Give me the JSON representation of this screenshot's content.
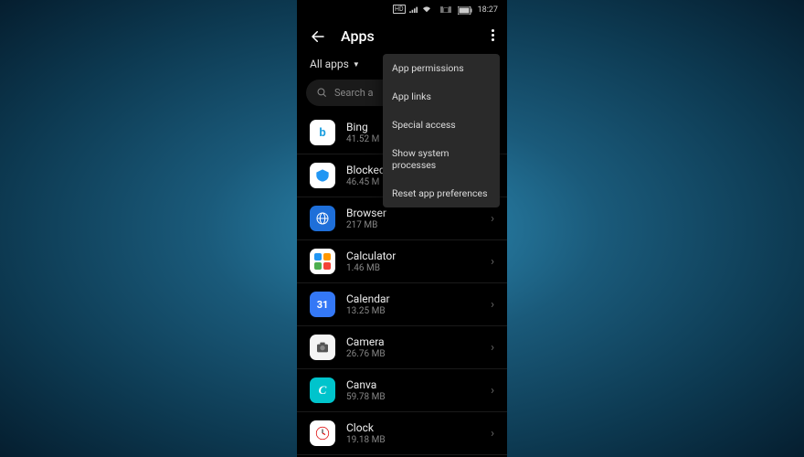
{
  "status": {
    "time": "18:27"
  },
  "header": {
    "title": "Apps"
  },
  "filter": {
    "label": "All apps"
  },
  "search": {
    "placeholder": "Search a"
  },
  "popup": {
    "items": [
      "App permissions",
      "App links",
      "Special access",
      "Show system processes",
      "Reset app preferences"
    ]
  },
  "apps": [
    {
      "name": "Bing",
      "size": "41.52 M"
    },
    {
      "name": "Blocked",
      "size": "46.45 M"
    },
    {
      "name": "Browser",
      "size": "217 MB"
    },
    {
      "name": "Calculator",
      "size": "1.46 MB"
    },
    {
      "name": "Calendar",
      "size": "13.25 MB"
    },
    {
      "name": "Camera",
      "size": "26.76 MB"
    },
    {
      "name": "Canva",
      "size": "59.78 MB"
    },
    {
      "name": "Clock",
      "size": "19.18 MB"
    }
  ]
}
